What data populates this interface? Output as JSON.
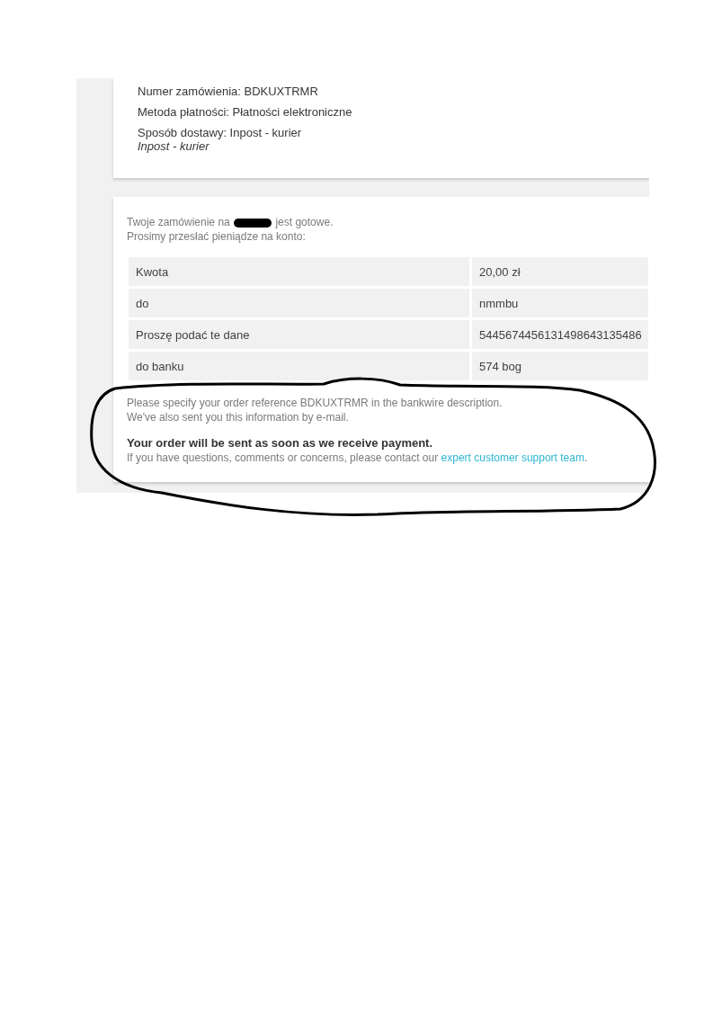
{
  "order_summary": {
    "lines": [
      "Numer zamówienia: BDKUXTRMR",
      "Metoda płatności: Płatności elektroniczne",
      "Sposób dostawy: Inpost - kurier"
    ],
    "delivery_note": "Inpost - kurier"
  },
  "bankwire": {
    "intro_before": "Twoje zamówienie na",
    "redacted": true,
    "intro_after": "jest gotowe.",
    "intro_line2": "Prosimy przesłać pieniądze na konto:",
    "rows": [
      {
        "label": "Kwota",
        "value": "20,00 zł"
      },
      {
        "label": "do",
        "value": "nmmbu"
      },
      {
        "label": "Proszę podać te dane",
        "value": "5445674456131498643135486"
      },
      {
        "label": "do banku",
        "value": "574 bog"
      }
    ],
    "reference_note": "Please specify your order reference BDKUXTRMR in the bankwire description.",
    "email_note": "We've also sent you this information by e-mail.",
    "headline": "Your order will be sent as soon as we receive payment.",
    "contact_text": "If you have questions, comments or concerns, please contact our",
    "contact_link": "expert customer support team",
    "contact_end": "."
  },
  "annotation": {
    "kind": "freehand-loop"
  }
}
